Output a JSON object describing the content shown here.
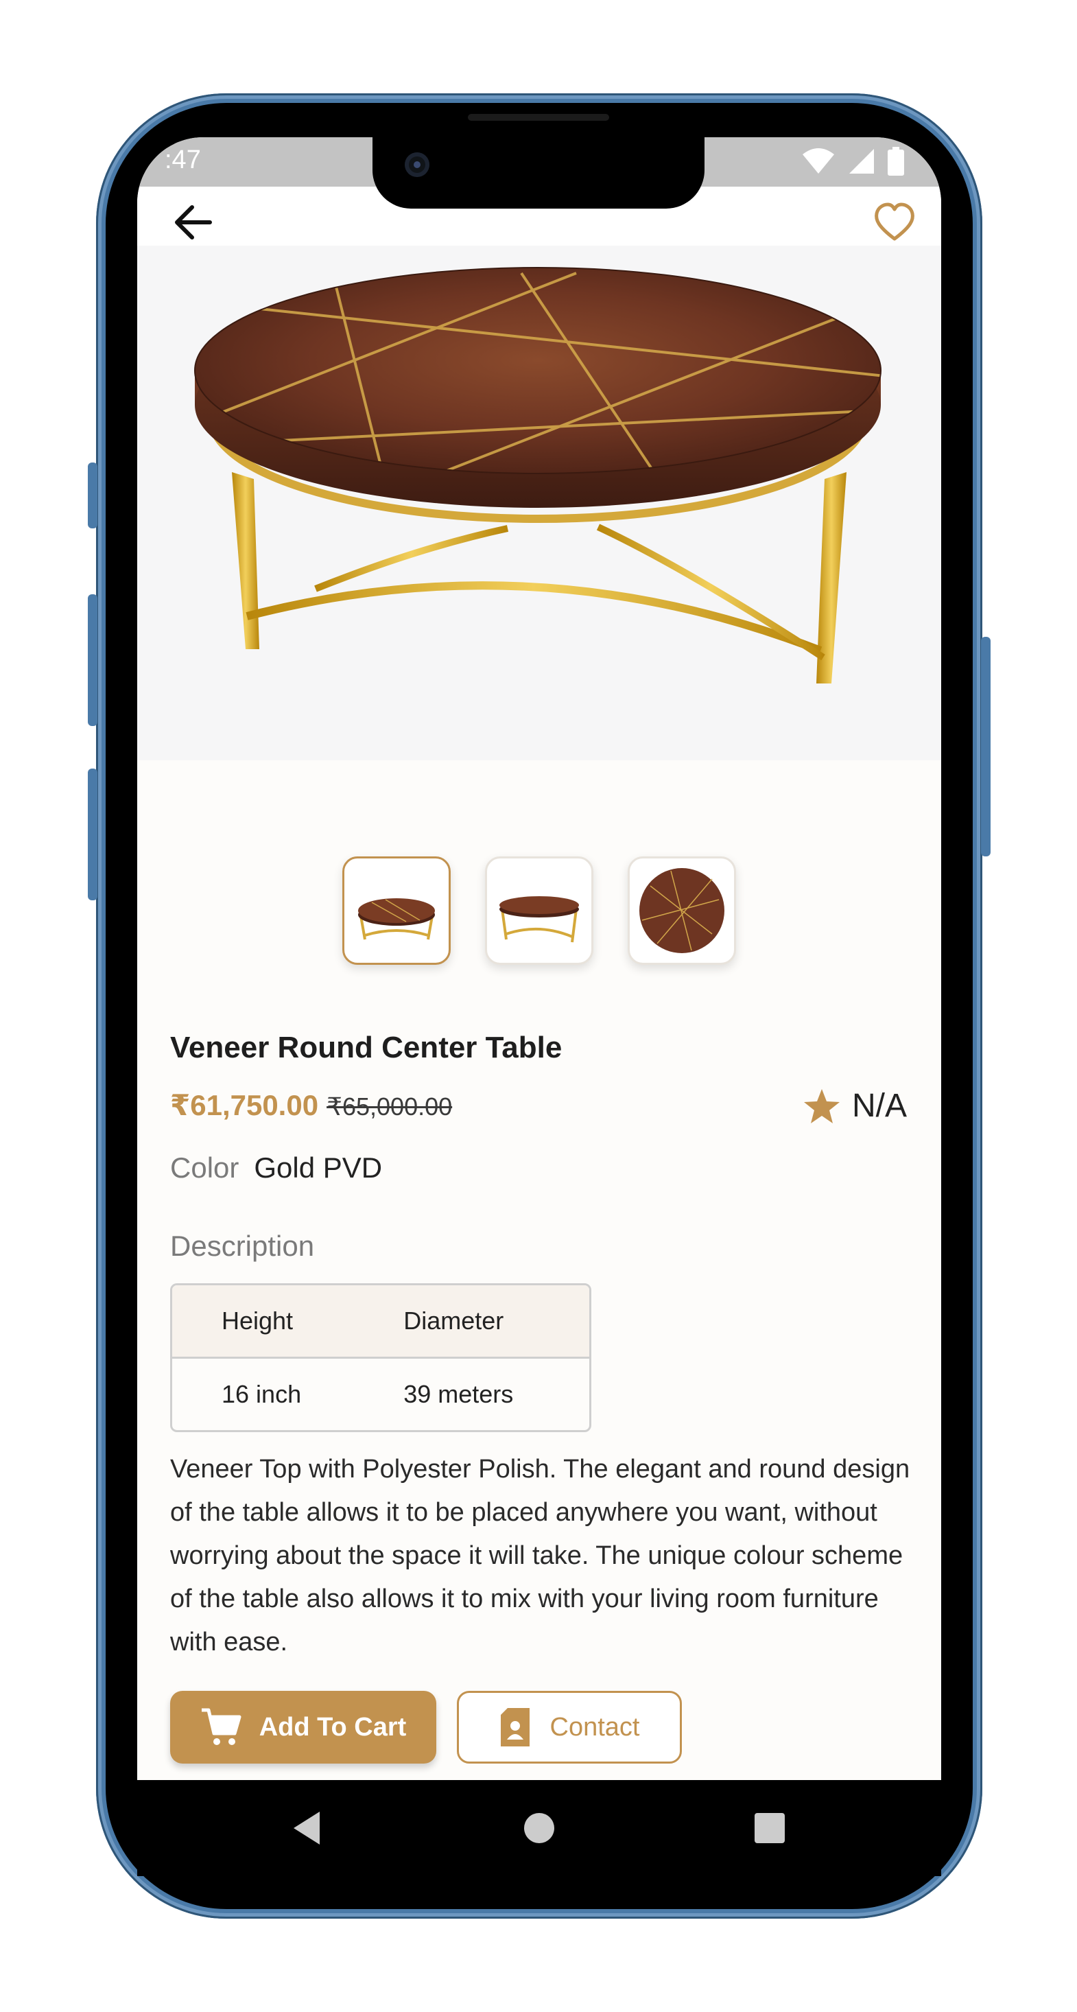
{
  "status_bar": {
    "time": ":47",
    "icons": [
      "wifi-icon",
      "signal-icon",
      "battery-icon"
    ]
  },
  "header": {
    "back_icon": "arrow-left-icon",
    "favorite_icon": "heart-outline-icon"
  },
  "gallery": {
    "thumbnails": [
      {
        "name": "thumbnail-1",
        "active": true
      },
      {
        "name": "thumbnail-2",
        "active": false
      },
      {
        "name": "thumbnail-3",
        "active": false
      }
    ]
  },
  "product": {
    "name": "Veneer Round Center Table",
    "price": "₹61,750.00",
    "original_price": "₹65,000.00",
    "rating": "N/A",
    "color_label": "Color",
    "color_value": "Gold PVD"
  },
  "description": {
    "title": "Description",
    "table_headers": [
      "Height",
      "Diameter"
    ],
    "table_rows": [
      [
        "16 inch",
        "39 meters"
      ]
    ],
    "text": "Veneer Top with Polyester Polish. The elegant and round design of the table allows it to be placed anywhere you want, without worrying about the space it will take. The unique colour scheme of the table also allows it to mix with your living room furniture with ease."
  },
  "actions": {
    "add_to_cart": "Add To Cart",
    "contact": "Contact"
  },
  "colors": {
    "accent": "#c2924f",
    "frame": "#4a7aa8",
    "background": "#fdfcfa"
  }
}
